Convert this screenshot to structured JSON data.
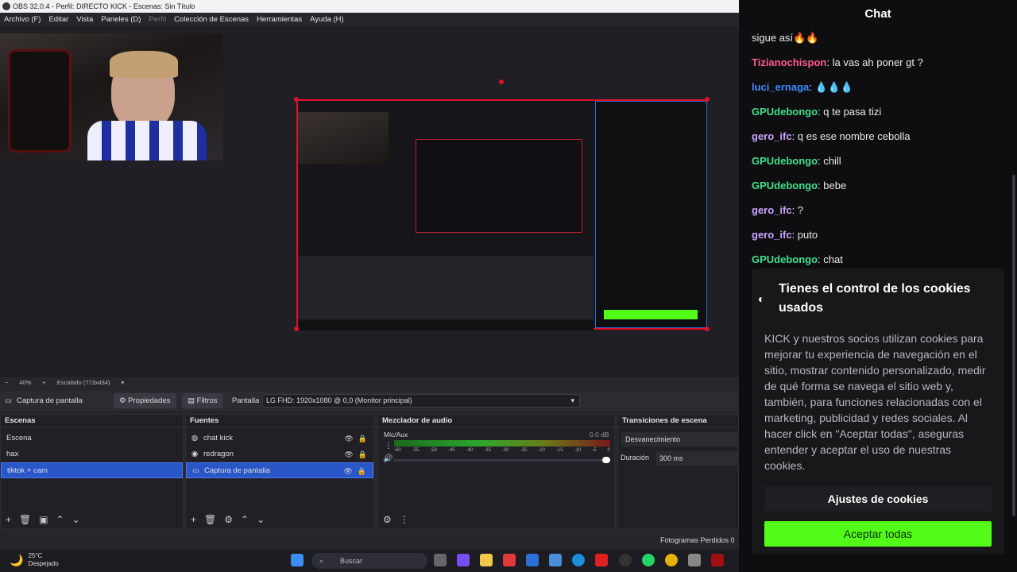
{
  "obs": {
    "title": "OBS 32.0.4 - Perfil: DIRECTO KICK - Escenas: Sin Título",
    "menu": [
      "Archivo (F)",
      "Editar",
      "Vista",
      "Paneles (D)",
      "Perfil",
      "Colección de Escenas",
      "Herramientas",
      "Ayuda (H)"
    ],
    "preview_status": {
      "zoom": "40%",
      "scaling": "Escalado (773x434)"
    },
    "toolbar": {
      "source_name": "Captura de pantalla",
      "properties": "Propiedades",
      "filters": "Filtros",
      "screen_label": "Pantalla",
      "screen_value": "LG FHD: 1920x1080 @ 0,0 (Monitor principal)"
    },
    "scenes": {
      "title": "Escenas",
      "items": [
        "Escena",
        "hax",
        "tiktok + cam"
      ],
      "active": 2
    },
    "sources": {
      "title": "Fuentes",
      "items": [
        "chat kick",
        "redragon",
        "Captura de pantalla"
      ],
      "active": 2
    },
    "mixer": {
      "title": "Mezclador de audio",
      "channel": "Mic/Aux",
      "level": "0.0 dB",
      "scale": [
        "-60",
        "-55",
        "-50",
        "-45",
        "-40",
        "-35",
        "-30",
        "-25",
        "-20",
        "-15",
        "-10",
        "-5",
        "0"
      ]
    },
    "transitions": {
      "title": "Transiciones de escena",
      "transition": "Desvanecimiento",
      "duration_label": "Duración",
      "duration_value": "300 ms"
    },
    "status_bar": "Fotogramas Perdidos 0 ("
  },
  "taskbar": {
    "temperature": "25°C",
    "weather": "Despejado",
    "search_placeholder": "Buscar"
  },
  "chat": {
    "title": "Chat",
    "messages": [
      {
        "user": "",
        "text": "sigue así🔥🔥",
        "color": "#eaeaea"
      },
      {
        "user": "Tizianochispon",
        "text": ": la vas ah poner gt ?",
        "color": "#ff5a8a"
      },
      {
        "user": "luci_ernaga",
        "text": ": 💧💧💧",
        "color": "#3d8bff"
      },
      {
        "user": "GPUdebongo",
        "text": ": q te pasa tizi",
        "color": "#42e08c"
      },
      {
        "user": "gero_ifc",
        "text": ": q es ese nombre cebolla",
        "color": "#c9a4ff"
      },
      {
        "user": "GPUdebongo",
        "text": ": chill",
        "color": "#42e08c"
      },
      {
        "user": "GPUdebongo",
        "text": ": bebe",
        "color": "#42e08c"
      },
      {
        "user": "gero_ifc",
        "text": ": ?",
        "color": "#c9a4ff"
      },
      {
        "user": "gero_ifc",
        "text": ": puto",
        "color": "#c9a4ff"
      },
      {
        "user": "GPUdebongo",
        "text": ": chat",
        "color": "#42e08c"
      }
    ],
    "cookie": {
      "title": "Tienes el control de los cookies usados",
      "body": "KICK y nuestros socios utilizan cookies para mejorar tu experiencia de navegación en el sitio, mostrar contenido personalizado, medir de qué forma se navega el sitio web y, también, para funciones relacionadas con el marketing, publicidad y redes sociales. Al hacer click en \"Aceptar todas\", aseguras entender y aceptar el uso de nuestras cookies.",
      "settings_label": "Ajustes de cookies",
      "accept_label": "Aceptar todas"
    }
  }
}
